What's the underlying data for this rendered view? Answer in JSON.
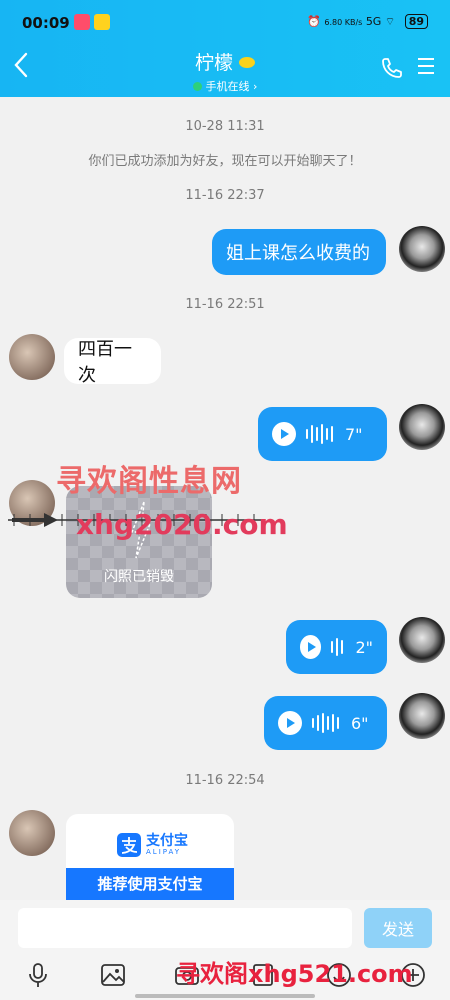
{
  "status_bar": {
    "time": "00:09",
    "network_speed": "6.80 KB/s",
    "network": "5G",
    "battery": "89"
  },
  "header": {
    "title": "柠檬",
    "subtitle": "手机在线 ›"
  },
  "messages": [
    {
      "type": "timestamp",
      "text": "10-28 11:31"
    },
    {
      "type": "system",
      "text": "你们已成功添加为好友，现在可以开始聊天了！"
    },
    {
      "type": "timestamp",
      "text": "11-16 22:37"
    },
    {
      "type": "text",
      "sender": "me",
      "text": "姐上课怎么收费的"
    },
    {
      "type": "timestamp",
      "text": "11-16 22:51"
    },
    {
      "type": "text",
      "sender": "her",
      "text": "四百一次"
    },
    {
      "type": "voice",
      "sender": "me",
      "duration": "7\""
    },
    {
      "type": "flash_image",
      "sender": "her",
      "label": "闪照已销毁"
    },
    {
      "type": "voice",
      "sender": "me",
      "duration": "2\""
    },
    {
      "type": "voice",
      "sender": "me",
      "duration": "6\""
    },
    {
      "type": "timestamp",
      "text": "11-16 22:54"
    },
    {
      "type": "alipay_card",
      "sender": "her",
      "brand": "支付宝",
      "brand_en": "ALIPAY",
      "banner": "推荐使用支付宝"
    }
  ],
  "watermarks": {
    "line1": "寻欢阁性息网",
    "line2": "xhg2020.com",
    "line3": "寻欢阁xhg521.com"
  },
  "input": {
    "value": "",
    "send_label": "发送"
  },
  "icons": [
    "back-icon",
    "phone-icon",
    "menu-icon",
    "voice-icon",
    "image-icon",
    "camera-icon",
    "file-icon",
    "emoji-icon",
    "add-icon"
  ],
  "colors": {
    "header": "#17b5f3",
    "sent_bubble": "#1e9bf6",
    "send_button": "#8fd2f8",
    "alipay": "#1677ff"
  }
}
